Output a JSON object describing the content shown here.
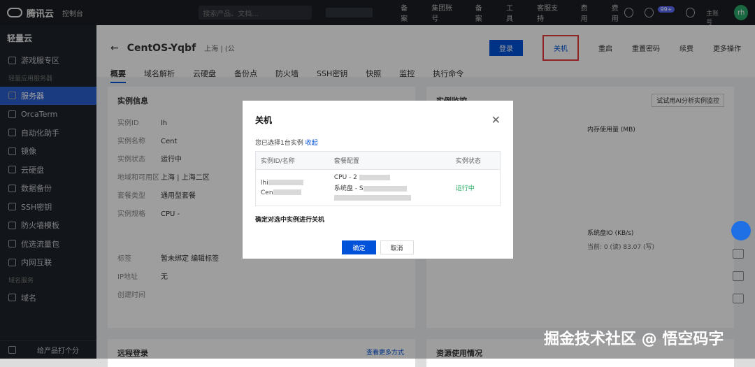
{
  "topbar": {
    "brand": "腾讯云",
    "console": "控制台",
    "search_placeholder": "搜索产品、文档...",
    "nav": [
      "备案",
      "集团账号",
      "备案",
      "工具",
      "客服支持",
      "费用",
      "费用"
    ],
    "notification_count": "99+",
    "account": "主账号",
    "avatar": "rh"
  },
  "sidebar": {
    "title": "轻量云",
    "items": [
      {
        "label": "游戏服专区"
      },
      {
        "section": "轻量应用服务器"
      },
      {
        "label": "服务器"
      },
      {
        "label": "OrcaTerm"
      },
      {
        "label": "自动化助手"
      },
      {
        "label": "镜像"
      },
      {
        "label": "云硬盘"
      },
      {
        "label": "数据备份"
      },
      {
        "label": "SSH密钥"
      },
      {
        "label": "防火墙模板"
      },
      {
        "label": "优选流量包"
      },
      {
        "label": "内网互联"
      },
      {
        "section": "域名服务"
      },
      {
        "label": "域名"
      }
    ],
    "footer": "给产品打个分"
  },
  "header": {
    "title": "CentOS-Yqbf",
    "region": "上海 | (公",
    "actions": [
      "登录",
      "关机",
      "重启",
      "重置密码",
      "续费",
      "更多操作"
    ],
    "tabs": [
      "概要",
      "域名解析",
      "云硬盘",
      "备份点",
      "防火墙",
      "SSH密钥",
      "快照",
      "监控",
      "执行命令"
    ]
  },
  "cards": {
    "instance_info": "实例信息",
    "monitor": "实例监控",
    "ai_button": "试试用AI分析实例监控",
    "mem": "内存使用量 (MB)",
    "disk_io": "系统盘IO (KB/s)",
    "disk_io_now": "当前: 0 (读) 83.07 (写)",
    "info_rows": [
      {
        "label": "实例ID",
        "value": "lh"
      },
      {
        "label": "实例名称",
        "value": "Cent"
      },
      {
        "label": "实例状态",
        "value": "运行中"
      },
      {
        "label": "地域和可用区",
        "value": "上海 | 上海二区"
      },
      {
        "label": "套餐类型",
        "value": "通用型套餐"
      },
      {
        "label": "实例规格",
        "value": "CPU -"
      },
      {
        "label": "标签",
        "value": "暂未绑定  编辑标签"
      },
      {
        "label": "IP地址",
        "value": "无"
      },
      {
        "label": "创建时间",
        "value": ""
      }
    ],
    "remote_login": "远程登录",
    "remote_link": "查看更多方式",
    "resource_usage": "资源使用情况"
  },
  "modal": {
    "title": "关机",
    "selected_text": "您已选择1台实例",
    "collapse": "收起",
    "columns": [
      "实例ID/名称",
      "套餐配置",
      "实例状态"
    ],
    "row": {
      "id": "lhi",
      "name": "Cen",
      "cpu": "CPU - 2",
      "disk": "系统盘 - S",
      "status": "运行中"
    },
    "confirm_text": "确定对选中实例进行关机",
    "ok": "确定",
    "cancel": "取消"
  },
  "watermark": "掘金技术社区 @ 悟空码字"
}
